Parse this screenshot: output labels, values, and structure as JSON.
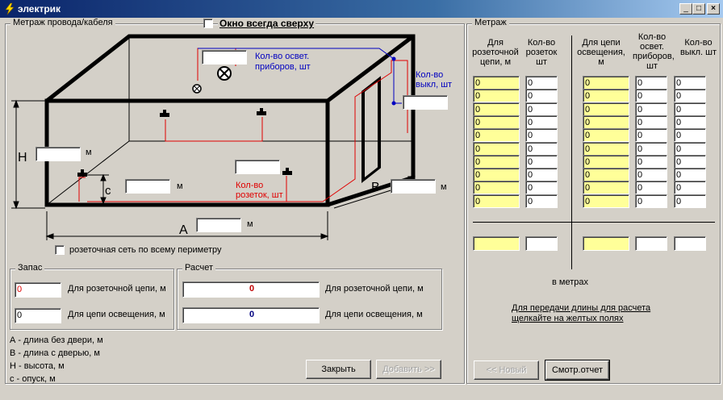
{
  "window": {
    "title": "электрик",
    "minimize": "_",
    "maximize": "□",
    "close": "×"
  },
  "left_group": {
    "title": "Метраж провода/кабеля"
  },
  "always_on_top": {
    "label": "Окно всегда сверху"
  },
  "diagram": {
    "lights_label": [
      "Кол-во освет.",
      "приборов, шт"
    ],
    "switches_label": [
      "Кол-во",
      "выкл, шт"
    ],
    "sockets_label": [
      "Кол-во",
      "розеток, шт"
    ],
    "H": "H",
    "c": "c",
    "A": "A",
    "B": "B",
    "unit": "м"
  },
  "perimeter": {
    "label": "розеточная сеть по всему периметру"
  },
  "reserve": {
    "title": "Запас",
    "socket_value": "0",
    "socket_label": "Для розеточной цепи, м",
    "light_value": "0",
    "light_label": "Для цепи освещения, м"
  },
  "calc": {
    "title": "Расчет",
    "socket_value": "0",
    "socket_label": "Для розеточной цепи, м",
    "light_value": "0",
    "light_label": "Для цепи освещения, м"
  },
  "legend": [
    "А - длина без двери, м",
    "В - длина с дверью, м",
    "Н - высота, м",
    "с - опуск, м"
  ],
  "buttons": {
    "close": "Закрыть",
    "add": "Добавить >>",
    "new": "<< Новый",
    "report": "Смотр.отчет"
  },
  "right_group": {
    "title": "Метраж",
    "headers": [
      "Для розеточной цепи, м",
      "Кол-во розеток шт",
      "Для цепи освещения, м",
      "Кол-во освет. приборов, шт",
      "Кол-во выкл. шт"
    ],
    "rows": [
      [
        "0",
        "0",
        "0",
        "0",
        "0"
      ],
      [
        "0",
        "0",
        "0",
        "0",
        "0"
      ],
      [
        "0",
        "0",
        "0",
        "0",
        "0"
      ],
      [
        "0",
        "0",
        "0",
        "0",
        "0"
      ],
      [
        "0",
        "0",
        "0",
        "0",
        "0"
      ],
      [
        "0",
        "0",
        "0",
        "0",
        "0"
      ],
      [
        "0",
        "0",
        "0",
        "0",
        "0"
      ],
      [
        "0",
        "0",
        "0",
        "0",
        "0"
      ],
      [
        "0",
        "0",
        "0",
        "0",
        "0"
      ],
      [
        "0",
        "0",
        "0",
        "0",
        "0"
      ]
    ],
    "in_meters": "в метрах",
    "hint": [
      "Для передачи длины для расчета",
      "щелкайте на желтых полях"
    ]
  },
  "colors": {
    "titlebar": "#0a246a",
    "yellow": "#ffff99",
    "wire": "#e00000",
    "blue": "#0000c0"
  }
}
